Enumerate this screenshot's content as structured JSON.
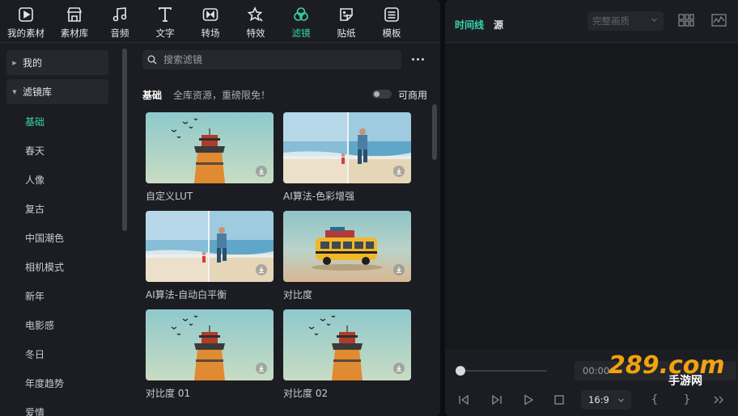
{
  "toolbar": [
    {
      "label": "我的素材",
      "icon": "my-media-icon"
    },
    {
      "label": "素材库",
      "icon": "store-icon"
    },
    {
      "label": "音频",
      "icon": "music-note-icon"
    },
    {
      "label": "文字",
      "icon": "text-icon"
    },
    {
      "label": "转场",
      "icon": "transition-icon"
    },
    {
      "label": "特效",
      "icon": "effects-star-icon"
    },
    {
      "label": "滤镜",
      "icon": "filter-icon"
    },
    {
      "label": "贴纸",
      "icon": "sticker-icon"
    },
    {
      "label": "模板",
      "icon": "template-icon"
    }
  ],
  "active_tool": "滤镜",
  "sidebar": {
    "heads": [
      {
        "label": "我的"
      },
      {
        "label": "滤镜库"
      }
    ],
    "items": [
      {
        "label": "基础"
      },
      {
        "label": "春天"
      },
      {
        "label": "人像"
      },
      {
        "label": "复古"
      },
      {
        "label": "中国潮色"
      },
      {
        "label": "相机模式"
      },
      {
        "label": "新年"
      },
      {
        "label": "电影感"
      },
      {
        "label": "冬日"
      },
      {
        "label": "年度趋势"
      },
      {
        "label": "爱情"
      }
    ],
    "active_item": "基础"
  },
  "search": {
    "placeholder": "搜索滤镜"
  },
  "category": {
    "title": "基础",
    "subtitle": "全库资源，重磅限免！",
    "toggle_label": "可商用",
    "toggle_on": false
  },
  "filters": [
    {
      "label": "自定义LUT",
      "scene": "lighthouse"
    },
    {
      "label": "AI算法-色彩增强",
      "scene": "beach-split"
    },
    {
      "label": "AI算法-自动白平衡",
      "scene": "beach-split"
    },
    {
      "label": "对比度",
      "scene": "bus"
    },
    {
      "label": "对比度 01",
      "scene": "lighthouse"
    },
    {
      "label": "对比度 02",
      "scene": "lighthouse"
    }
  ],
  "preview": {
    "tabs": [
      {
        "label": "时间线"
      },
      {
        "label": "源"
      }
    ],
    "active_tab": "时间线",
    "quality": "完整画质",
    "timecode": "00:00",
    "aspect_ratio": "16:9",
    "watermark_text": "289.com",
    "watermark_sub": "手游网",
    "playhead": 0,
    "colors": {
      "accent": "#35d6b0",
      "watermark": "#f2a20f"
    }
  }
}
